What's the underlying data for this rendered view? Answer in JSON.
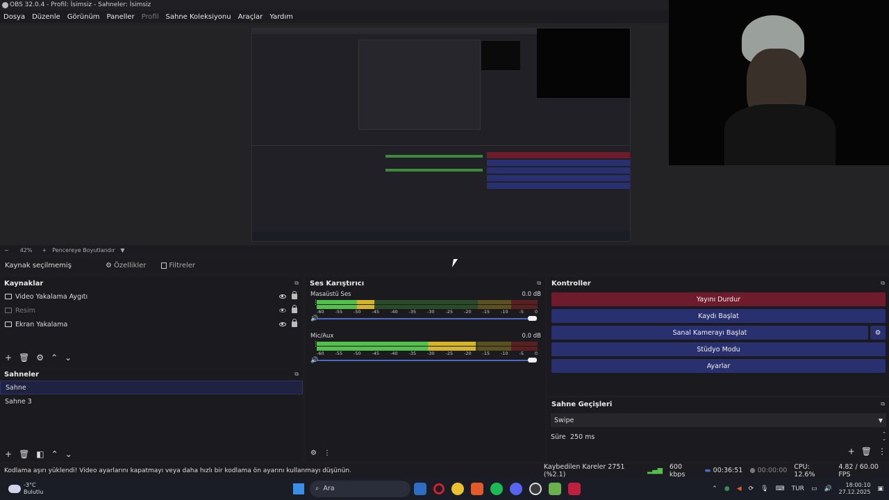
{
  "window": {
    "title": "OBS 32.0.4 - Profil: İsimsiz - Sahneler: İsimsiz"
  },
  "menu": [
    "Dosya",
    "Düzenle",
    "Görünüm",
    "Paneller",
    "Profil",
    "Sahne Koleksiyonu",
    "Araçlar",
    "Yardım"
  ],
  "zoom": {
    "minus": "−",
    "value": "42%",
    "plus": "+",
    "mode": "Pencereye Boyutlandır"
  },
  "source_toolbar": {
    "none_selected": "Kaynak seçilmemiş",
    "properties": "Özellikler",
    "filters": "Filtreler"
  },
  "sources": {
    "title": "Kaynaklar",
    "items": [
      {
        "label": "Video Yakalama Aygıtı",
        "visible": true
      },
      {
        "label": "Resim",
        "visible": false
      },
      {
        "label": "Ekran Yakalama",
        "visible": true
      }
    ]
  },
  "scenes": {
    "title": "Sahneler",
    "items": [
      {
        "label": "Sahne",
        "selected": true
      },
      {
        "label": "Sahne 3",
        "selected": false
      }
    ]
  },
  "mixer": {
    "title": "Ses Karıştırıcı",
    "ticks": [
      "-60",
      "-55",
      "-50",
      "-45",
      "-40",
      "-35",
      "-30",
      "-25",
      "-20",
      "-15",
      "-10",
      "-5",
      "0"
    ],
    "channels": [
      {
        "name": "Masaüstü Ses",
        "db": "0.0 dB",
        "level": 0.26
      },
      {
        "name": "Mic/Aux",
        "db": "0.0 dB",
        "level": 0.72
      }
    ]
  },
  "controls": {
    "title": "Kontroller",
    "buttons": [
      "Yayını Durdur",
      "Kaydı Başlat",
      "Sanal Kamerayı Başlat",
      "Stüdyo Modu",
      "Ayarlar"
    ]
  },
  "transitions": {
    "title": "Sahne Geçişleri",
    "selected": "Swipe",
    "duration_label": "Süre",
    "duration": "250 ms"
  },
  "status": {
    "message": "Kodlama aşırı yüklendi! Video ayarlarını kapatmayı veya daha hızlı bir kodlama ön ayarını kullanmayı düşünün.",
    "dropped": "Kaybedilen Kareler 2751 (%2.1)",
    "bitrate": "600 kbps",
    "live_time": "00:36:51",
    "rec_time": "00:00:00",
    "cpu": "CPU: 12.6%",
    "fps": "4.82 / 60.00 FPS"
  },
  "taskbar": {
    "weather_temp": "-3°C",
    "weather_desc": "Bulutlu",
    "search": "Ara",
    "lang": "TUR",
    "time": "18:00:10",
    "date": "27.12.2025"
  },
  "colors": {
    "stop_stream": "#6e1c2c",
    "button": "#283070",
    "accent": "#4c6ac6"
  }
}
